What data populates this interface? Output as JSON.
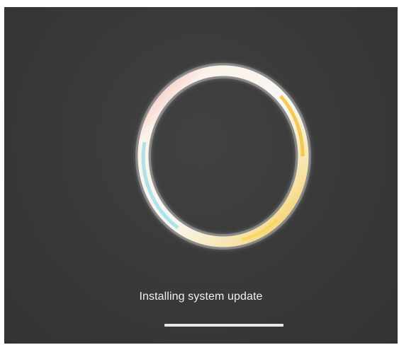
{
  "screen": {
    "status_text": "Installing system update",
    "progress": 1.0,
    "icons": {
      "boot_logo": "android-ring-logo"
    },
    "colors": {
      "background": "#3a3a3a",
      "ring": "#f6f4ee",
      "ring_accent_yellow": "#f5c23a",
      "ring_accent_cyan": "#6fd3e6",
      "ring_accent_pink": "#f3a6a6",
      "text": "#f2f2f2",
      "progress_fill": "#e8e8e8"
    }
  }
}
